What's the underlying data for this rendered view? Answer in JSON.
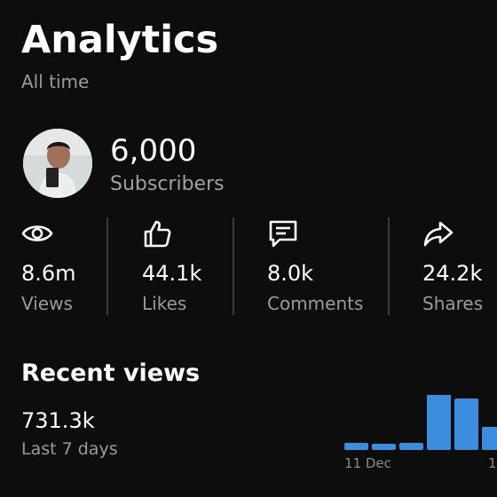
{
  "header": {
    "title": "Analytics",
    "period": "All time"
  },
  "channel": {
    "subscribers_value": "6,000",
    "subscribers_label": "Subscribers"
  },
  "stats": [
    {
      "icon": "eye-icon",
      "value": "8.6m",
      "label": "Views"
    },
    {
      "icon": "thumbs-up-icon",
      "value": "44.1k",
      "label": "Likes"
    },
    {
      "icon": "comment-icon",
      "value": "8.0k",
      "label": "Comments"
    },
    {
      "icon": "share-icon",
      "value": "24.2k",
      "label": "Shares"
    }
  ],
  "recent": {
    "title": "Recent views",
    "value": "731.3k",
    "period_label": "Last 7 days",
    "bar_color": "#3b8ede"
  },
  "chart_data": {
    "type": "bar",
    "categories": [
      "",
      "",
      "",
      "",
      "",
      ""
    ],
    "values": [
      8,
      7,
      8,
      64,
      58,
      26
    ],
    "x_tick_labels": [
      "11 Dec",
      "1"
    ]
  }
}
